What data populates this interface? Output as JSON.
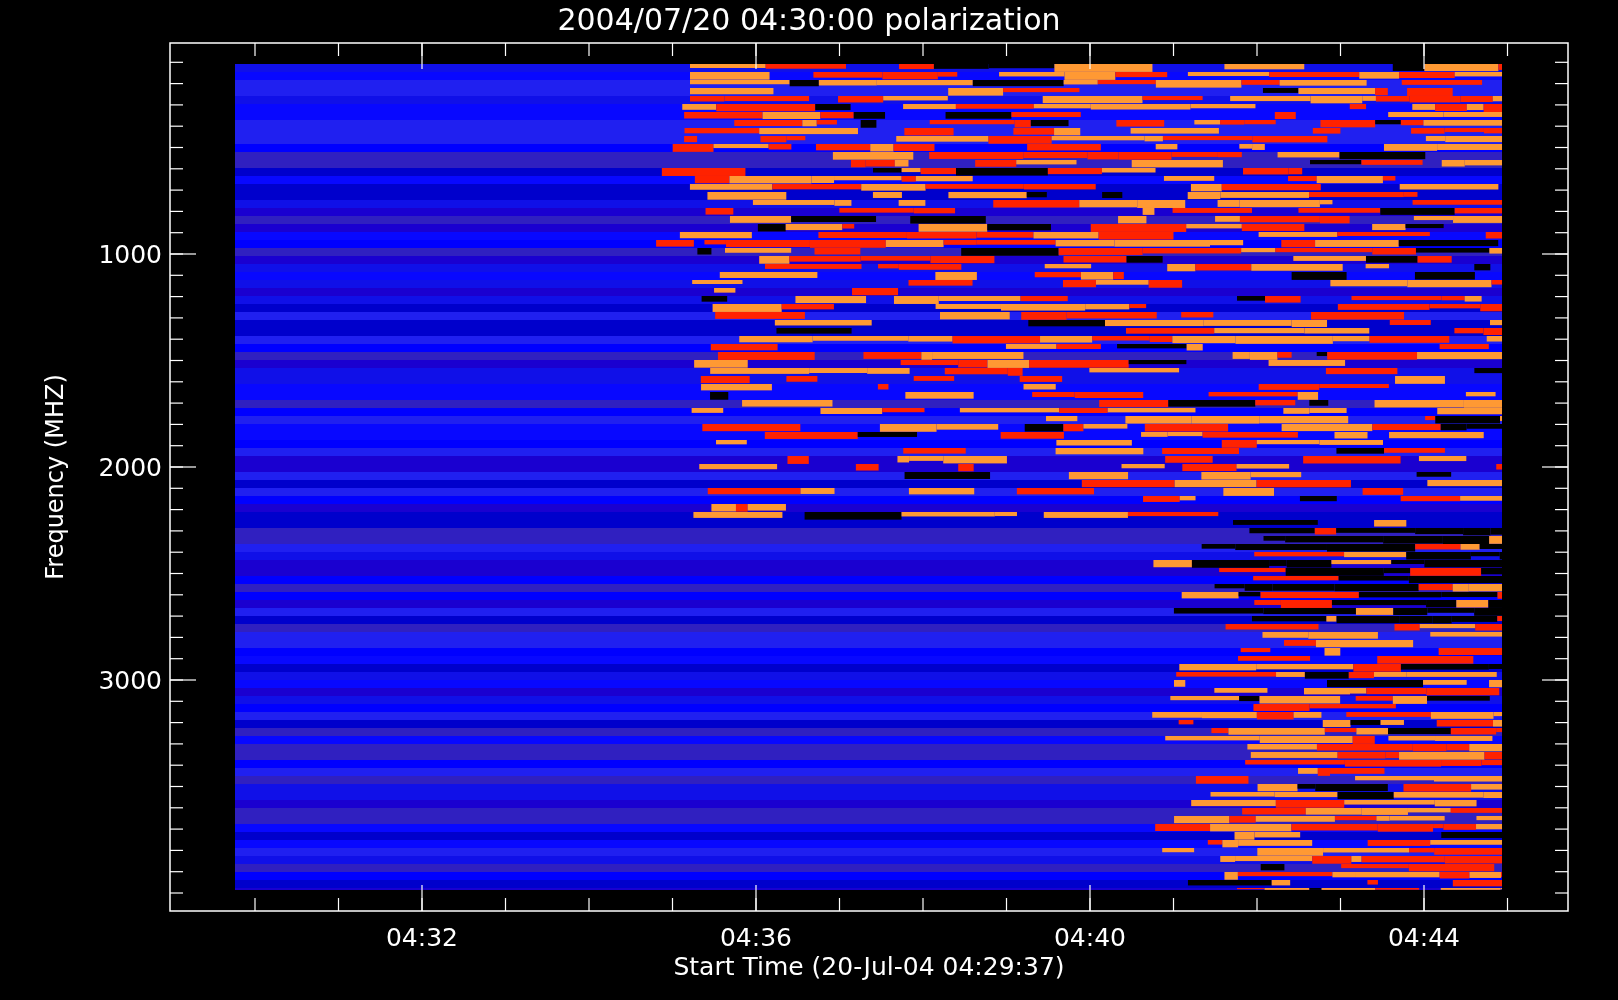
{
  "title": "2004/07/20 04:30:00 polarization",
  "y_axis": {
    "label": "Frequency (MHZ)",
    "ticks": [
      "1000",
      "2000",
      "3000"
    ]
  },
  "x_axis": {
    "label": "Start Time (20-Jul-04 04:29:37)",
    "ticks": [
      "04:32",
      "04:36",
      "04:40",
      "04:44"
    ]
  }
}
